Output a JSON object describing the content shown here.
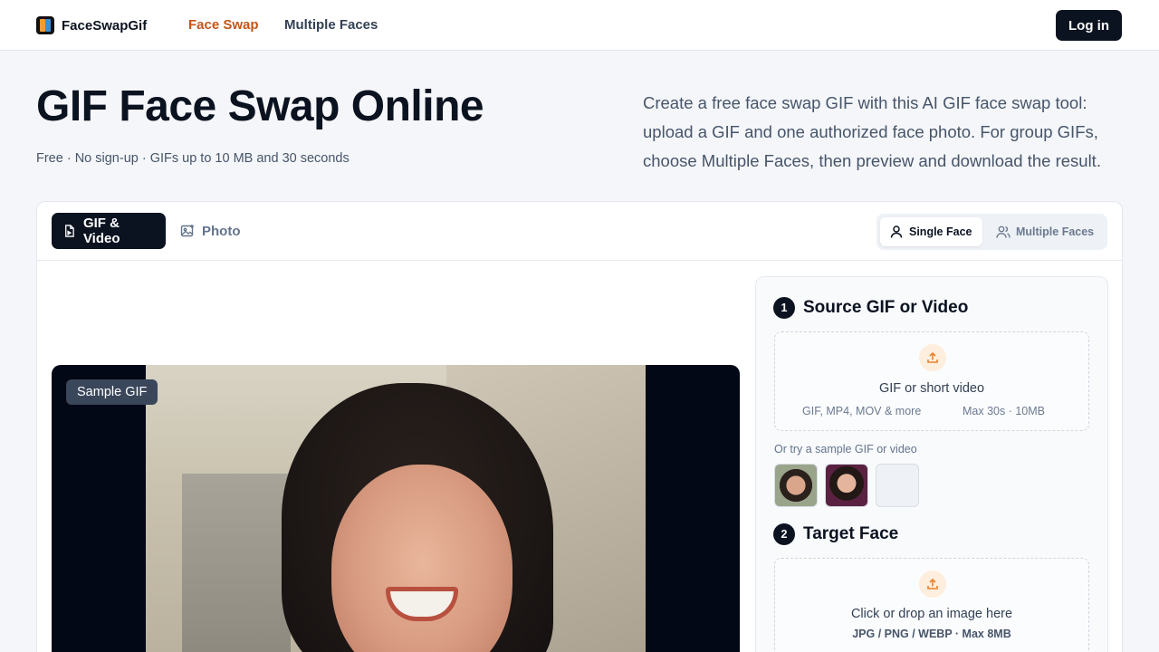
{
  "nav": {
    "brand": "FaceSwapGif",
    "links": [
      {
        "label": "Face Swap",
        "active": true
      },
      {
        "label": "Multiple Faces",
        "active": false
      }
    ],
    "login_label": "Log in"
  },
  "hero": {
    "title": "GIF Face Swap Online",
    "subtitle": "Free · No sign-up · GIFs up to 10 MB and 30 seconds",
    "description": "Create a free face swap GIF with this AI GIF face swap tool: upload a GIF and one authorized face photo. For group GIFs, choose Multiple Faces, then preview and download the result."
  },
  "tool": {
    "tabs": [
      {
        "label": "GIF & Video",
        "active": true,
        "icon": "gif-file-icon"
      },
      {
        "label": "Photo",
        "active": false,
        "icon": "image-icon"
      }
    ],
    "mode": [
      {
        "label": "Single Face",
        "active": true,
        "icon": "user-icon"
      },
      {
        "label": "Multiple Faces",
        "active": false,
        "icon": "users-icon"
      }
    ],
    "preview_badge": "Sample GIF"
  },
  "panel": {
    "step1": {
      "num": "1",
      "title": "Source GIF or Video",
      "drop_title": "GIF or short video",
      "formats": "GIF, MP4, MOV & more",
      "limits": "Max 30s · 10MB",
      "try_label": "Or try a sample GIF or video"
    },
    "step2": {
      "num": "2",
      "title": "Target Face",
      "drop_title": "Click or drop an image here",
      "formats": "JPG / PNG / WEBP · Max 8MB"
    }
  },
  "colors": {
    "accent": "#c2561a",
    "dark": "#0b1220",
    "upload_icon": "#e8842e"
  }
}
